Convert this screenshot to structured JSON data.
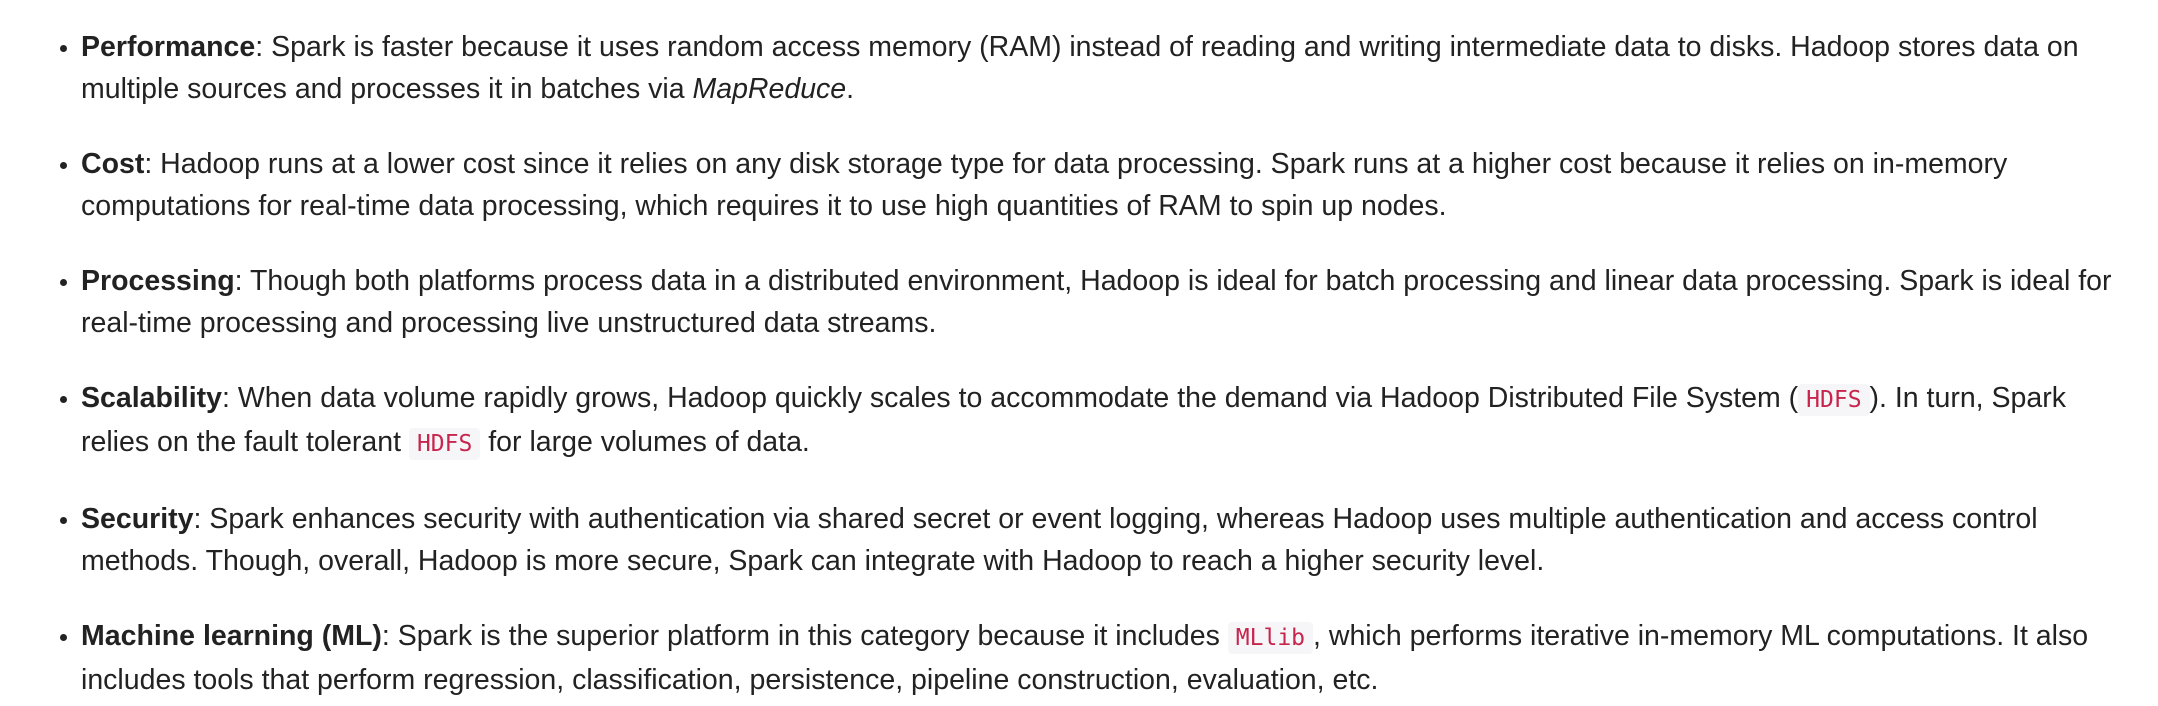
{
  "items": [
    {
      "term": "Performance",
      "text1": ": Spark is faster because it uses random access memory (RAM) instead of reading and writing intermediate data to disks. Hadoop stores data on multiple sources and processes it in batches via ",
      "emph": "MapReduce",
      "text2": "."
    },
    {
      "term": "Cost",
      "text1": ": Hadoop runs at a lower cost since it relies on any disk storage type for data processing. Spark runs at a higher cost because it relies on in-memory computations for real-time data processing, which requires it to use high quantities of RAM to spin up nodes."
    },
    {
      "term": "Processing",
      "text1": ": Though both platforms process data in a distributed environment, Hadoop is ideal for batch processing and linear data processing. Spark is ideal for real-time processing and processing live unstructured data streams."
    },
    {
      "term": "Scalability",
      "text1": ": When data volume rapidly grows, Hadoop quickly scales to accommodate the demand via Hadoop Distributed File System (",
      "code1": "HDFS",
      "text2": "). In turn, Spark relies on the fault tolerant ",
      "code2": "HDFS",
      "text3": " for large volumes of data."
    },
    {
      "term": "Security",
      "text1": ": Spark enhances security with authentication via shared secret or event logging, whereas Hadoop uses multiple authentication and access control methods. Though, overall, Hadoop is more secure, Spark can integrate with Hadoop to reach a higher security level."
    },
    {
      "term": "Machine learning (ML)",
      "text1": ": Spark is the superior platform in this category because it includes ",
      "code1": "MLlib",
      "text2": ", which performs iterative in-memory ML computations. It also includes tools that perform regression, classification, persistence, pipeline construction, evaluation, etc."
    }
  ]
}
